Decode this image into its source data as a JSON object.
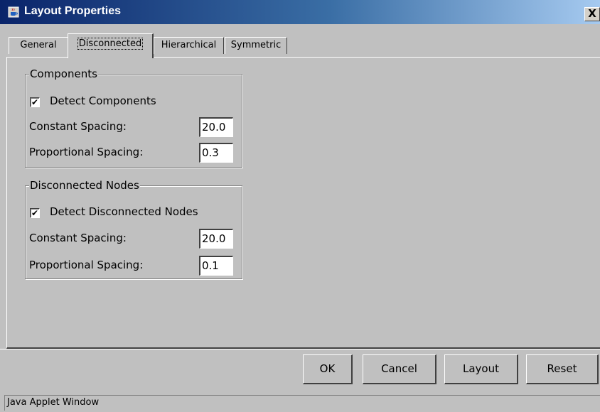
{
  "window": {
    "title": "Layout Properties",
    "close_label": "X",
    "status": "Java Applet Window"
  },
  "tabs": [
    {
      "label": "General",
      "active": false
    },
    {
      "label": "Disconnected",
      "active": true
    },
    {
      "label": "Hierarchical",
      "active": false
    },
    {
      "label": "Symmetric",
      "active": false
    }
  ],
  "components": {
    "title": "Components",
    "detect_label": "Detect Components",
    "detect_checked": true,
    "constant_label": "Constant Spacing:",
    "constant_value": "20.0",
    "proportional_label": "Proportional Spacing:",
    "proportional_value": "0.3"
  },
  "disconnected": {
    "title": "Disconnected Nodes",
    "detect_label": "Detect Disconnected Nodes",
    "detect_checked": true,
    "constant_label": "Constant Spacing:",
    "constant_value": "20.0",
    "proportional_label": "Proportional Spacing:",
    "proportional_value": "0.1"
  },
  "buttons": {
    "ok": "OK",
    "cancel": "Cancel",
    "layout": "Layout",
    "reset": "Reset"
  },
  "icons": {
    "app": "java-cup-icon",
    "check": "check-mark-icon"
  },
  "colors": {
    "title_start": "#0a246a",
    "title_end": "#a6caf0",
    "face": "#c0c0c0"
  }
}
